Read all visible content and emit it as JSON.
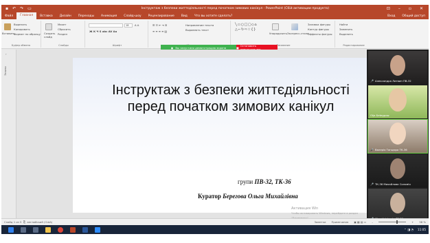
{
  "window": {
    "title": "Інструктаж з безпеки життєдіяльності перед початком зимових канікул - PowerPoint (Сбій активации продукта)",
    "qat_icons": [
      "save-icon",
      "undo-icon",
      "redo-icon",
      "present-icon"
    ]
  },
  "tabs": [
    "Файл",
    "Главная",
    "Вставка",
    "Дизайн",
    "Переходы",
    "Анимация",
    "Слайд-шоу",
    "Рецензирование",
    "Вид",
    "Что вы хотите сделать?"
  ],
  "tabs_right": {
    "signin": "Вход",
    "share": "Общий доступ"
  },
  "ribbon": {
    "clipboard": {
      "paste": "Вставить",
      "cut": "Вырезать",
      "copy": "Копировать",
      "format": "Формат по образцу",
      "label": "Буфер обмена"
    },
    "slides": {
      "new": "Создать слайд",
      "layout": "Макет",
      "reset": "Сбросить",
      "section": "Раздел",
      "label": "Слайды"
    },
    "font": {
      "size": "18",
      "label": "Шрифт"
    },
    "paragraph": {
      "direction": "Направление текста",
      "align": "Выровнять текст",
      "label": "Абзац"
    },
    "drawing": {
      "arrange": "Упорядочить",
      "styles": "Экспресс-стили",
      "fill": "Заливка фигуры",
      "outline": "Контур фигуры",
      "effects": "Эффекты фигуры",
      "label": "Рисование"
    },
    "editing": {
      "find": "Найти",
      "replace": "Заменить",
      "select": "Выделить",
      "label": "Редактирование"
    }
  },
  "share_bar": {
    "status": "Вы запустили демонстрацию экрана",
    "stop": "Остановить демонстрацию"
  },
  "thumbs": {
    "label": "Эскизы"
  },
  "slide": {
    "title": "Інструктаж з безпеки життєдіяльності перед початком зимових канікул",
    "group_prefix": "групи",
    "group_value": "ПВ-32, ТК-36",
    "curator_prefix": "Куратор",
    "curator_value": "Берегова Ольга Михайлівна"
  },
  "activation": {
    "title": "Активация Win",
    "sub": "Чтобы активировать Windows, перейдите в раздел \"Параметры\"."
  },
  "participants": [
    {
      "name": "Александра Литвин ПВ-32",
      "muted": true,
      "active": false
    },
    {
      "name": "Olja Беtegpow",
      "muted": false,
      "active": false
    },
    {
      "name": "Валерія Танцюра ТК-36",
      "muted": true,
      "active": true
    },
    {
      "name": "ТК-36 Михайлова Соломія",
      "muted": true,
      "active": false
    },
    {
      "name": "Olga Volchenko TK-36",
      "muted": true,
      "active": false
    }
  ],
  "status": {
    "slide": "Слайд 1 из 5",
    "lang": "английский (США)",
    "notes": "Заметки",
    "comments": "Примечания",
    "zoom": "58 %"
  },
  "taskbar": {
    "time": "11:05",
    "icons": [
      "start-icon",
      "search-icon",
      "task-view-icon",
      "explorer-icon",
      "chrome-icon",
      "powerpoint-icon",
      "word-icon",
      "zoom-icon"
    ]
  },
  "colors": {
    "accent": "#b7472a",
    "share_green": "#3fb24f",
    "share_red": "#e81123",
    "taskbar": "#18253a"
  }
}
